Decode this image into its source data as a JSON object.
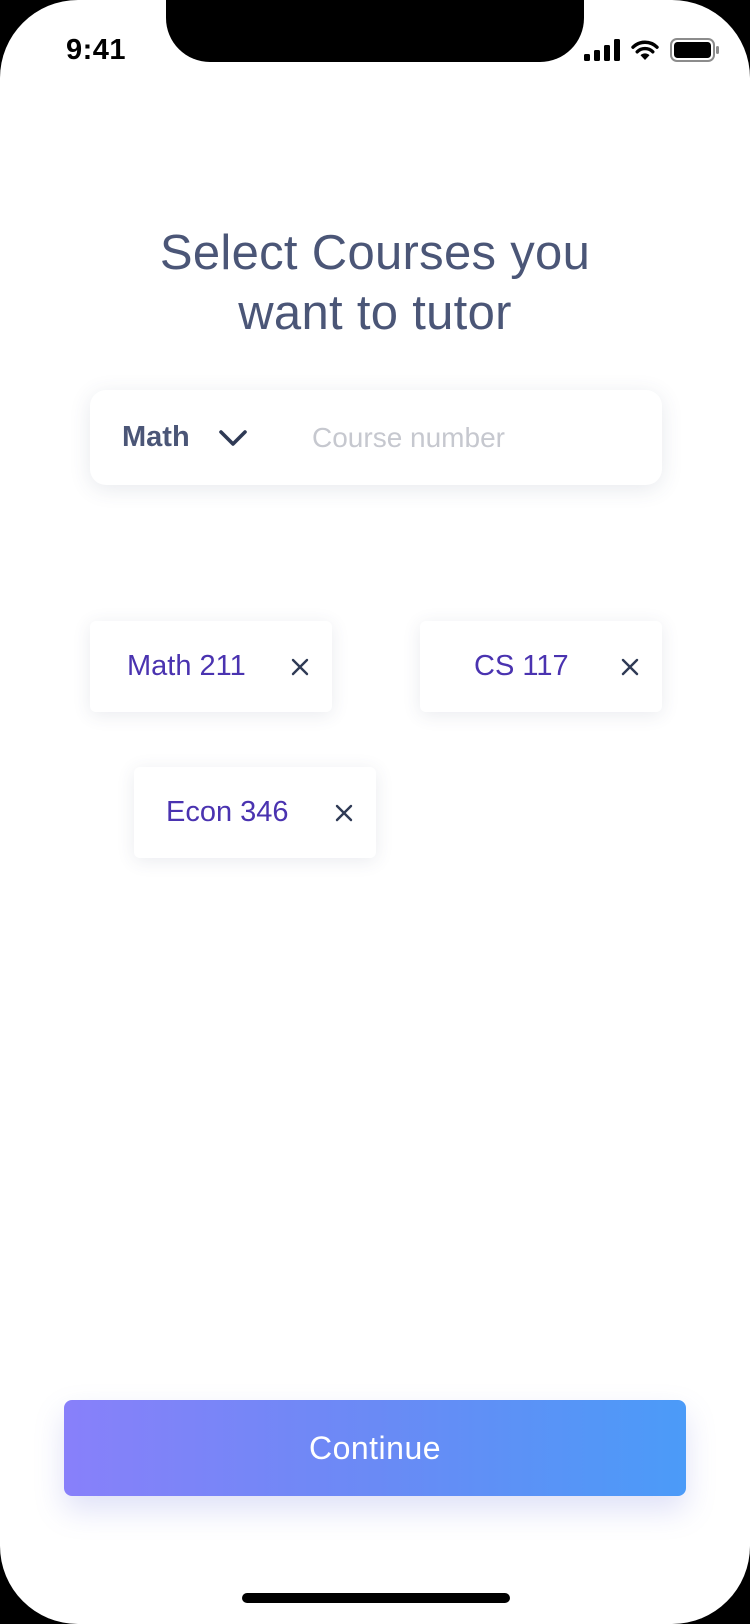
{
  "status_bar": {
    "time": "9:41",
    "icons": [
      "signal-icon",
      "wifi-icon",
      "battery-icon"
    ]
  },
  "title": {
    "line1": "Select Courses you",
    "line2": "want to tutor"
  },
  "course_search": {
    "subject": "Math",
    "subject_icon": "chevron-down-icon",
    "course_number_value": "",
    "course_number_placeholder": "Course number"
  },
  "selected_courses": [
    {
      "label": "Math 211",
      "remove_icon": "close-icon"
    },
    {
      "label": "CS 117",
      "remove_icon": "close-icon"
    },
    {
      "label": "Econ 346",
      "remove_icon": "close-icon"
    }
  ],
  "continue_label": "Continue",
  "colors": {
    "title": "#4b5677",
    "chip_text": "#4a33b0",
    "placeholder": "#c6c8cf",
    "button_gradient_start": "#8880fa",
    "button_gradient_end": "#4b9bf8",
    "button_text": "#ffffff"
  }
}
